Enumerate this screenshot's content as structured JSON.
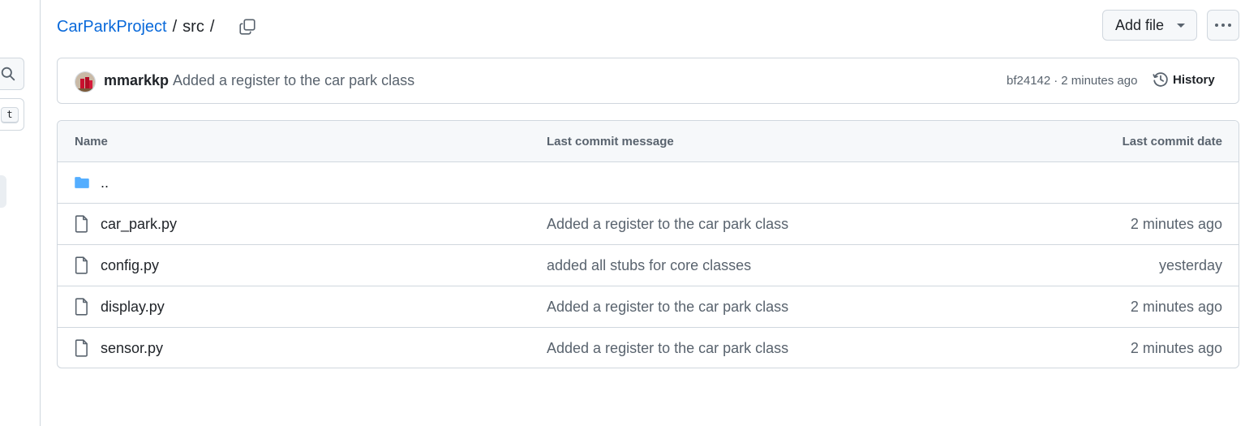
{
  "sidebar": {
    "kbd_hint": "t"
  },
  "breadcrumb": {
    "repo": "CarParkProject",
    "separator": "/",
    "current": "src",
    "trailing_separator": "/"
  },
  "toolbar": {
    "add_file_label": "Add file"
  },
  "latest_commit": {
    "author": "mmarkkp",
    "message": "Added a register to the car park class",
    "sha": "bf24142",
    "dot": "·",
    "time": "2 minutes ago",
    "history_label": "History"
  },
  "table": {
    "headers": {
      "name": "Name",
      "message": "Last commit message",
      "date": "Last commit date"
    },
    "parent": "..",
    "rows": [
      {
        "name": "car_park.py",
        "message": "Added a register to the car park class",
        "date": "2 minutes ago"
      },
      {
        "name": "config.py",
        "message": "added all stubs for core classes",
        "date": "yesterday"
      },
      {
        "name": "display.py",
        "message": "Added a register to the car park class",
        "date": "2 minutes ago"
      },
      {
        "name": "sensor.py",
        "message": "Added a register to the car park class",
        "date": "2 minutes ago"
      }
    ]
  },
  "colors": {
    "link": "#0969da",
    "folder": "#54aeff",
    "muted": "#59636e",
    "border": "#d0d7de"
  }
}
